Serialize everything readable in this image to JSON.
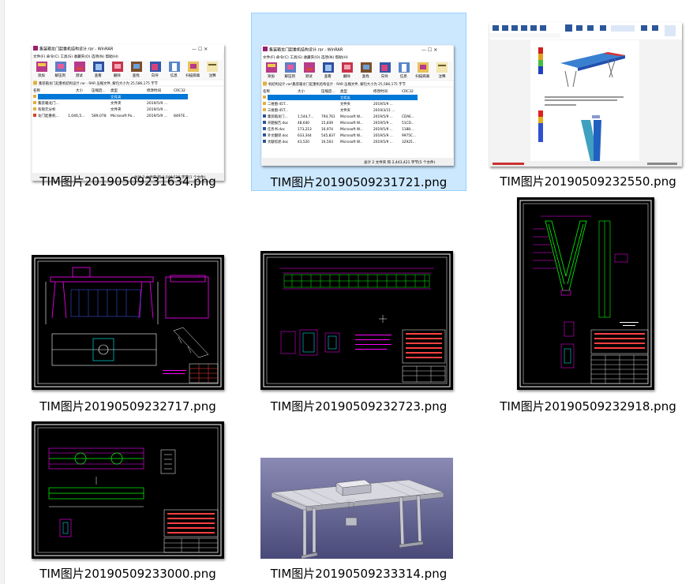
{
  "colors": {
    "selection_bg": "#cce8ff",
    "selection_border": "#99d1ff",
    "cad_background": "#000000",
    "cad_magenta": "#ff00ff",
    "cad_green": "#00ff00",
    "render_background": "#5a5a8c"
  },
  "files": [
    {
      "name": "TIM图片20190509231634.png",
      "kind": "winrar-screenshot",
      "selected": false,
      "preview": {
        "title": "集装箱龙门起重机结构设计.rar - WinRAR",
        "menu": "文件(F)  命令(C)  工具(S)  收藏夹(O)  选项(N)  帮助(H)",
        "tools": [
          "添加",
          "解压到",
          "测试",
          "查看",
          "删除",
          "查找",
          "向导",
          "信息",
          "扫描病毒",
          "注释"
        ],
        "path": "集装箱龙门起重机结构设计.rar - RAR 压缩文件, 解包大小为 25,586,175 字节",
        "headers": [
          "名称",
          "大小",
          "压缩后...",
          "类型",
          "修改时间",
          "CRC32"
        ],
        "rows": [
          [
            "..",
            "",
            "",
            "文件夹",
            "",
            ""
          ],
          [
            "集装箱龙门...",
            "",
            "",
            "文件夹",
            "2019/5/9 ...",
            ""
          ],
          [
            "有限元分析",
            "",
            "",
            "文件夹",
            "2019/5/9 ...",
            ""
          ],
          [
            "龙门起重机...",
            "1,046,5...",
            "589,078",
            "Microsoft Po...",
            "2019/5/9 ...",
            "8497E..."
          ]
        ],
        "status": "总计 2 文件夹 和 1,046,528 字节(1 个文件)"
      }
    },
    {
      "name": "TIM图片20190509231721.png",
      "kind": "winrar-screenshot",
      "selected": true,
      "preview": {
        "title": "集装箱龙门起重机结构设计.rar - WinRAR",
        "menu": "文件(F)  命令(C)  工具(S)  收藏夹(O)  选项(N)  帮助(H)",
        "tools": [
          "添加",
          "解压到",
          "测试",
          "查看",
          "删除",
          "查找",
          "向导",
          "信息",
          "扫描病毒",
          "注释"
        ],
        "path": "机结构设计.rar\\集装箱龙门起重机结构设计 - RAR 压缩文件, 解包大小为 25,586,175 字节",
        "headers": [
          "名称",
          "大小",
          "压缩后...",
          "类型",
          "修改时间",
          "CRC32"
        ],
        "rows": [
          [
            "..",
            "",
            "",
            "文件夹",
            "",
            ""
          ],
          [
            "二维图-45T...",
            "",
            "",
            "文件夹",
            "2019/5/9 ...",
            ""
          ],
          [
            "三维图-45T...",
            "",
            "",
            "文件夹",
            "2019/3/11 ...",
            ""
          ],
          [
            "集装箱龙门...",
            "1,544,7...",
            "794,761",
            "Microsoft W...",
            "2019/5/9 ...",
            "CDAE..."
          ],
          [
            "开题报告.doc",
            "48,640",
            "15,839",
            "Microsoft W...",
            "2019/5/9 ...",
            "51CD..."
          ],
          [
            "任务书.doc",
            "173,213",
            "16,974",
            "Microsoft W...",
            "2019/5/9 ...",
            "1188..."
          ],
          [
            "外文翻译.doc",
            "633,344",
            "545,837",
            "Microsoft W...",
            "2019/5/9 ...",
            "9975C..."
          ],
          [
            "文献综述.doc",
            "43,520",
            "16,503",
            "Microsoft W...",
            "2019/5/9 ...",
            "32925..."
          ]
        ],
        "status": "总计 2 文件夹 和 2,443,421 字节(5 个文件)"
      }
    },
    {
      "name": "TIM图片20190509232550.png",
      "kind": "word-fea-screenshot",
      "selected": false
    },
    {
      "name": "TIM图片20190509232717.png",
      "kind": "cad-drawing",
      "selected": false
    },
    {
      "name": "TIM图片20190509232723.png",
      "kind": "cad-drawing",
      "selected": false
    },
    {
      "name": "TIM图片20190509232918.png",
      "kind": "cad-drawing",
      "selected": false
    },
    {
      "name": "TIM图片20190509233000.png",
      "kind": "cad-drawing",
      "selected": false
    },
    {
      "name": "TIM图片20190509233314.png",
      "kind": "3d-render",
      "selected": false
    }
  ]
}
